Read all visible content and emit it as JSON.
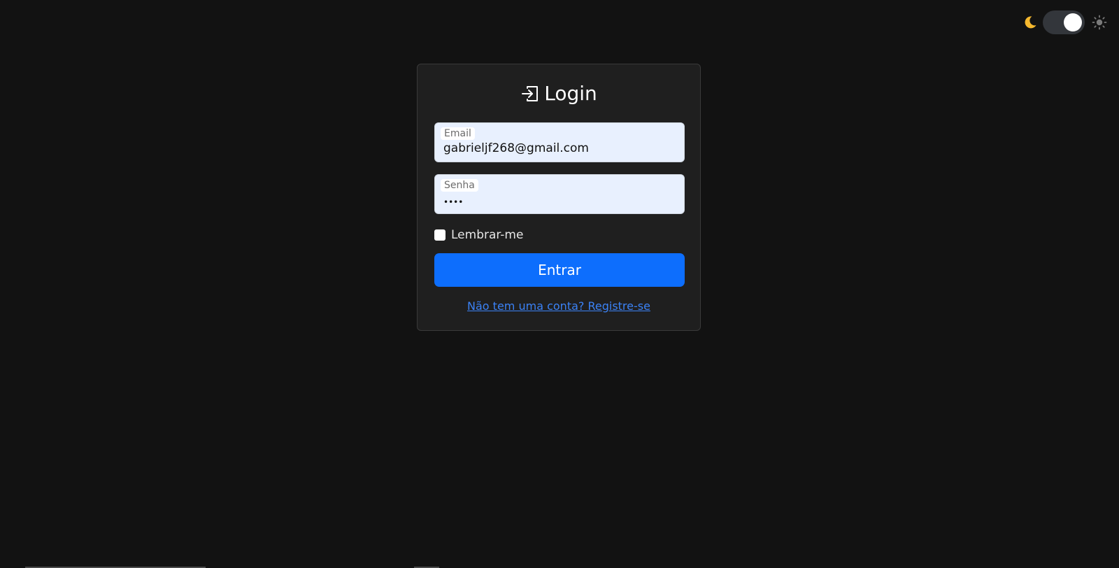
{
  "theme_toggle": {
    "moon_icon": "moon-icon",
    "sun_icon": "sun-icon",
    "state": "dark",
    "moon_color": "#f5b82e",
    "track_color": "#33363b"
  },
  "login": {
    "title": "Login",
    "title_icon": "box-arrow-in-right-icon",
    "email": {
      "label": "Email",
      "value": "gabrieljf268@gmail.com"
    },
    "password": {
      "label": "Senha",
      "value": "••••"
    },
    "remember_label": "Lembrar-me",
    "submit_label": "Entrar",
    "register_link": "Não tem uma conta? Registre-se"
  },
  "colors": {
    "background": "#121212",
    "card": "#1f1f1f",
    "primary": "#0d6efd",
    "link": "#3b82f6",
    "input_bg": "#e8f0fe"
  }
}
